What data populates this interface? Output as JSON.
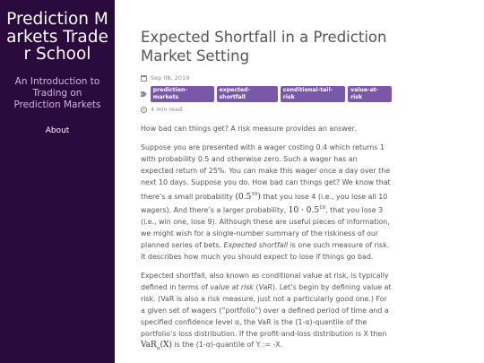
{
  "sidebar": {
    "site_title": "Prediction Markets Trader School",
    "description": "An Introduction to Trading on Prediction Markets",
    "nav": {
      "about": "About"
    }
  },
  "post": {
    "title": "Expected Shortfall in a Prediction Market Setting",
    "date": "Sep 08, 2019",
    "tags": [
      "prediction-markets",
      "expected-shortfall",
      "conditional-tail-risk",
      "value-at-risk"
    ],
    "read_time": "4 min read",
    "icons": {
      "date": "calendar-icon",
      "tags": "tags-icon",
      "read_time": "clock-icon"
    },
    "tag_color": "#7a58a8",
    "sidebar_color": "#2b0a3d",
    "intro": "How bad can things get? A risk measure provides an answer.",
    "p2": {
      "a": "Suppose you are presented with a wager costing 0.4 which returns 1 with probability 0.5 and otherwise zero. Such a wager has an expected return of 25%. You can make this wager once a day over the next 10 days. Suppose you do. How bad can things get? We know that there’s a small probability ",
      "m1_base": "(0.5",
      "m1_exp": "10",
      "m1_close": ")",
      "b": " that you lose 4 (i.e., you lose all 10 wagers). And there’s a larger probability, ",
      "m2_base": "10 · 0.5",
      "m2_exp": "10",
      "c": ", that you lose 3 (i.e., win one, lose 9). Although these are useful pieces of information, we might wish for a single-number summary of the riskiness of our planned series of bets. ",
      "em": "Expected shortfall",
      "d": " is one such measure of risk. It describes how much you should expect to lose if things go bad."
    },
    "p3": {
      "a": "Expected shortfall, also known as conditional value at risk, is typically defined in terms of ",
      "em1": "value at risk",
      "b": " (",
      "em2": "VaR",
      "c": "). Let’s begin by defining value at risk. (VaR is also a risk measure, just not a particularly good one.) For a given set of wagers (“portfolio”) over a defined period of time and a specified confidence level α, the VaR is the (1-α)-quantile of the portfolio’s loss distribution. If the profit-and-loss distribution is X then ",
      "m_base": "VaR",
      "m_sub": "α",
      "m_arg": "(X)",
      "d": " is the (1-α)-quantile of Y := -X."
    }
  }
}
